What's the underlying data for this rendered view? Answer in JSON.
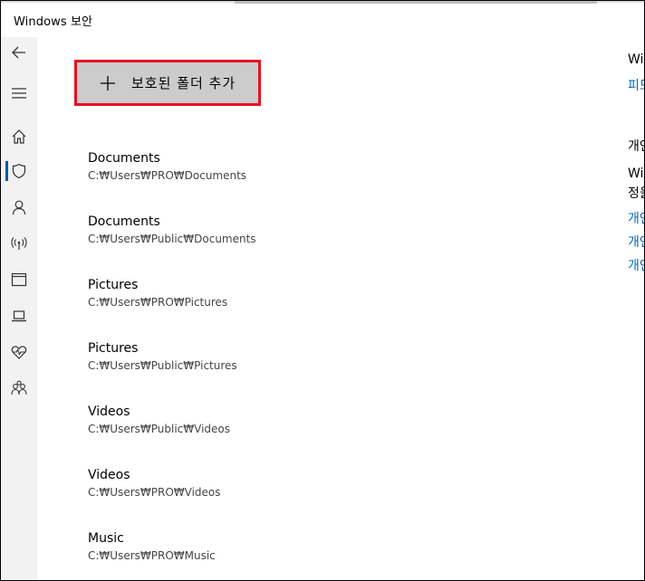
{
  "window": {
    "title": "Windows 보안"
  },
  "sidebar": {
    "items": [
      {
        "icon": "back-arrow-icon",
        "label": "Back"
      },
      {
        "icon": "hamburger-menu-icon",
        "label": "Menu"
      },
      {
        "icon": "home-icon",
        "label": "Home"
      },
      {
        "icon": "shield-icon",
        "label": "Virus & threat protection",
        "active": true
      },
      {
        "icon": "person-icon",
        "label": "Account protection"
      },
      {
        "icon": "wifi-antenna-icon",
        "label": "Firewall & network protection"
      },
      {
        "icon": "browser-window-icon",
        "label": "App & browser control"
      },
      {
        "icon": "laptop-icon",
        "label": "Device security"
      },
      {
        "icon": "heart-pulse-icon",
        "label": "Device performance & health"
      },
      {
        "icon": "family-icon",
        "label": "Family options"
      }
    ]
  },
  "main": {
    "add_button_label": "보호된 폴더 추가",
    "folders": [
      {
        "name": "Documents",
        "path": "C:₩Users₩PRO₩Documents"
      },
      {
        "name": "Documents",
        "path": "C:₩Users₩Public₩Documents"
      },
      {
        "name": "Pictures",
        "path": "C:₩Users₩PRO₩Pictures"
      },
      {
        "name": "Pictures",
        "path": "C:₩Users₩Public₩Pictures"
      },
      {
        "name": "Videos",
        "path": "C:₩Users₩Public₩Videos"
      },
      {
        "name": "Videos",
        "path": "C:₩Users₩PRO₩Videos"
      },
      {
        "name": "Music",
        "path": "C:₩Users₩PRO₩Music"
      }
    ]
  },
  "right_panel": {
    "heading": "Wi",
    "link1": "피드",
    "heading2": "개인",
    "text1": "Wi",
    "text2": "정을",
    "link2": "개인",
    "link3": "개인",
    "link4": "개인"
  },
  "colors": {
    "accent": "#0067b8",
    "highlight_border": "#e81123",
    "sidebar_bg": "#f2f2f2",
    "button_bg": "#cccccc"
  }
}
